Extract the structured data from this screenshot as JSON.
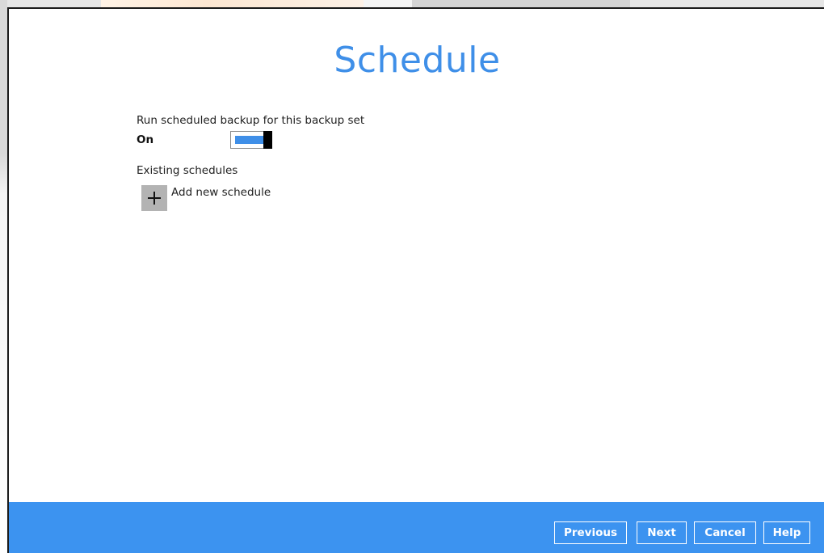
{
  "page": {
    "title": "Schedule"
  },
  "scheduled_backup": {
    "label": "Run scheduled backup for this backup set",
    "state_text": "On",
    "enabled": true
  },
  "existing_schedules": {
    "label": "Existing schedules",
    "add_label": "Add new schedule",
    "add_icon": "plus-icon"
  },
  "footer": {
    "previous_label": "Previous",
    "next_label": "Next",
    "cancel_label": "Cancel",
    "help_label": "Help"
  },
  "colors": {
    "accent": "#3f8fe8",
    "footer": "#3c93f0",
    "toggle_knob": "#000000",
    "add_button": "#b3b3b3"
  }
}
